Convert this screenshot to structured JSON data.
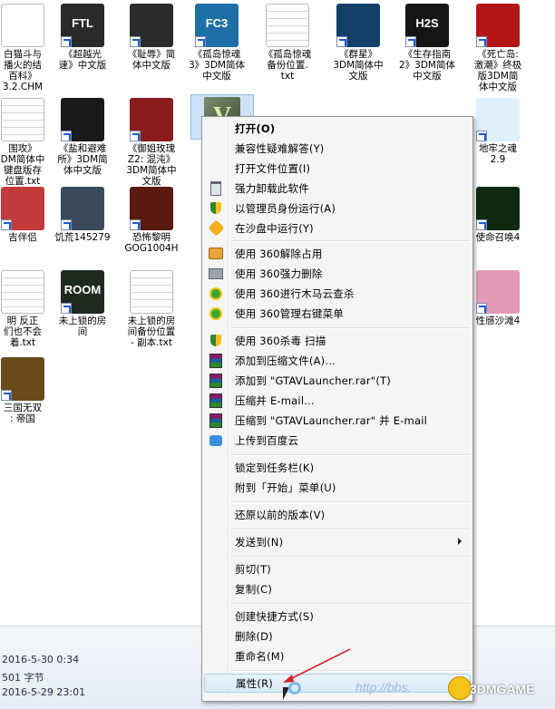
{
  "desktop_icons": [
    {
      "label": "白猫斗与\n播火的结\n百科》\n3.2.CHM",
      "color": "#ffffff",
      "kind": "chm"
    },
    {
      "label": "《超越光\n速》中文版",
      "color": "#2a2a2a",
      "kind": "app",
      "badge": "FTL"
    },
    {
      "label": "《耻辱》简\n体中文版",
      "color": "#2b2b2b",
      "kind": "app"
    },
    {
      "label": "《孤岛惊魂\n3》3DM简体\n中文版",
      "color": "#1f6fa7",
      "kind": "app",
      "badge": "FC3"
    },
    {
      "label": "《孤岛惊魂\n备份位置.\ntxt",
      "color": "#ffffff",
      "kind": "txt"
    },
    {
      "label": "《群星》\n3DM简体中\n文版",
      "color": "#133f6a",
      "kind": "app"
    },
    {
      "label": "《生存指南\n2》3DM简体\n中文版",
      "color": "#151515",
      "kind": "app",
      "badge": "H2S"
    },
    {
      "label": "《死亡岛:\n激潮》终极\n版3DM简\n体中文版",
      "color": "#b31616",
      "kind": "app"
    },
    {
      "label": "围攻》\nDM简体中\n键盘版存\n位置.txt",
      "color": "#ffffff",
      "kind": "txt"
    },
    {
      "label": "《盐和避难\n所》3DM简\n体中文版",
      "color": "#1a1a1a",
      "kind": "app"
    },
    {
      "label": "《御姐玫瑰\nZ2: 混沌》\n3DM简体中\n文版",
      "color": "#8a1c1c",
      "kind": "app"
    },
    {
      "label": "地牢之魂\n2.9",
      "color": "#dff1fb",
      "kind": "app"
    },
    {
      "label": "吉伴侣",
      "color": "#c33a3a",
      "kind": "app"
    },
    {
      "label": "饥荒145279",
      "color": "#3a4a5c",
      "kind": "app"
    },
    {
      "label": "恐怖黎明\nGOG1004H",
      "color": "#5a1a10",
      "kind": "app"
    },
    {
      "label": "使命召唤4",
      "color": "#0e2a12",
      "kind": "app"
    },
    {
      "label": "明 反正\n们也不会\n着.txt",
      "color": "#ffffff",
      "kind": "txt"
    },
    {
      "label": "未上锁的房\n间",
      "color": "#1f2a1f",
      "kind": "app",
      "badge": "ROOM"
    },
    {
      "label": "未上锁的房\n间备份位置\n- 副本.txt",
      "color": "#ffffff",
      "kind": "txt"
    },
    {
      "label": "性感沙滩4",
      "color": "#e29ab8",
      "kind": "app"
    },
    {
      "label": "三国无双\n: 帝国",
      "color": "#6b4a1a",
      "kind": "app"
    }
  ],
  "details_pane": {
    "modified": "2016-5-30 0:34",
    "size": "501 字节",
    "created": "2016-5-29 23:01"
  },
  "context_menu": {
    "items": [
      {
        "label": "打开(O)",
        "bold": true,
        "icon": ""
      },
      {
        "label": "兼容性疑难解答(Y)",
        "icon": ""
      },
      {
        "label": "打开文件位置(I)",
        "icon": ""
      },
      {
        "label": "强力卸载此软件",
        "icon": "trash-icon"
      },
      {
        "label": "以管理员身份运行(A)",
        "icon": "shield-icon"
      },
      {
        "label": "在沙盘中运行(Y)",
        "icon": "sandbox-icon"
      },
      {
        "label": "使用 360解除占用",
        "icon": "unlock-icon"
      },
      {
        "label": "使用 360强力删除",
        "icon": "shredder-icon"
      },
      {
        "label": "使用 360进行木马云查杀",
        "icon": "360-icon"
      },
      {
        "label": "使用 360管理右键菜单",
        "icon": "360-icon"
      },
      {
        "label": "使用 360杀毒 扫描",
        "icon": "shield-icon"
      },
      {
        "label": "添加到压缩文件(A)...",
        "icon": "rar-icon"
      },
      {
        "label": "添加到 \"GTAVLauncher.rar\"(T)",
        "icon": "rar-icon"
      },
      {
        "label": "压缩并 E-mail...",
        "icon": "rar-icon"
      },
      {
        "label": "压缩到 \"GTAVLauncher.rar\" 并 E-mail",
        "icon": "rar-icon"
      },
      {
        "label": "上传到百度云",
        "icon": "cloud-icon"
      },
      {
        "label": "锁定到任务栏(K)",
        "icon": ""
      },
      {
        "label": "附到「开始」菜单(U)",
        "icon": ""
      },
      {
        "label": "还原以前的版本(V)",
        "icon": ""
      },
      {
        "label": "发送到(N)",
        "icon": "",
        "submenu": true
      },
      {
        "label": "剪切(T)",
        "icon": ""
      },
      {
        "label": "复制(C)",
        "icon": ""
      },
      {
        "label": "创建快捷方式(S)",
        "icon": ""
      },
      {
        "label": "删除(D)",
        "icon": ""
      },
      {
        "label": "重命名(M)",
        "icon": ""
      },
      {
        "label": "属性(R)",
        "icon": "",
        "hover": true
      }
    ]
  },
  "watermark": "http://bbs.",
  "brand": "3DMGAME",
  "colors": {
    "menu_bg": "#f5f5f5",
    "menu_border": "#979797",
    "hover_bg": "#d8e8f8",
    "hover_border": "#a8cbef",
    "details_bg": "#e6edf6",
    "annotation_arrow": "#d42020"
  }
}
